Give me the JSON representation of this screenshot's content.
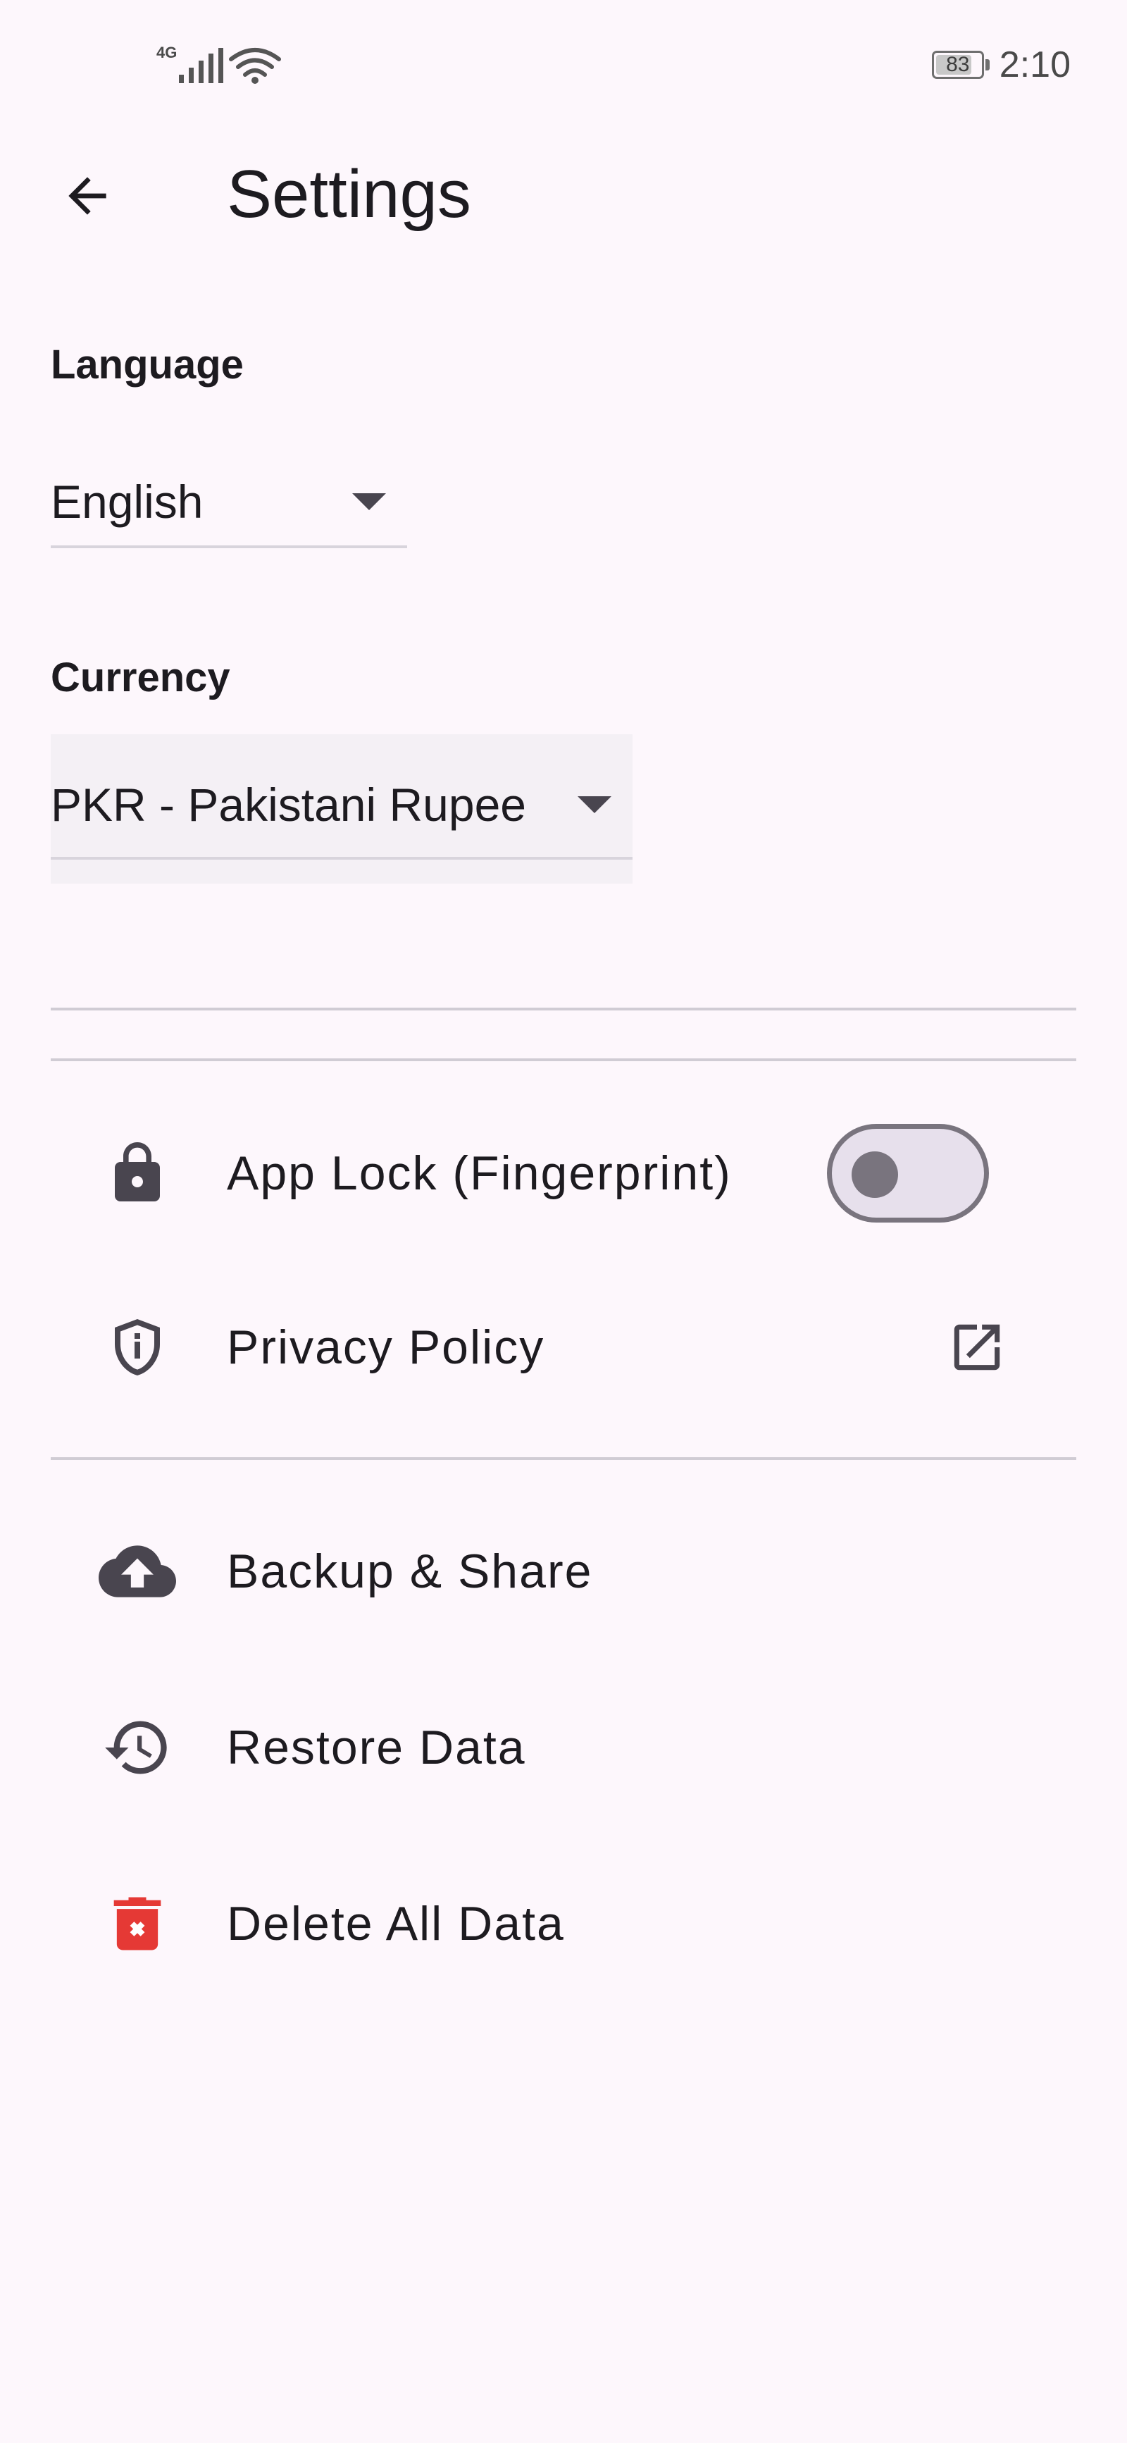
{
  "status_bar": {
    "network_type": "4G",
    "battery_level": "83",
    "battery_fraction": 0.83,
    "time": "2:10"
  },
  "app_bar": {
    "title": "Settings",
    "back_icon": "arrow-back-icon"
  },
  "language": {
    "label": "Language",
    "selected": "English"
  },
  "currency": {
    "label": "Currency",
    "selected": "PKR - Pakistani Rupee"
  },
  "settings_list": [
    {
      "label": "App Lock (Fingerprint)",
      "icon": "lock-icon",
      "trailing": "switch",
      "switch_on": false
    },
    {
      "label": "Privacy Policy",
      "icon": "shield-info-icon",
      "trailing": "external-link-icon"
    },
    {
      "label": "Backup & Share",
      "icon": "cloud-upload-icon"
    },
    {
      "label": "Restore Data",
      "icon": "history-icon"
    },
    {
      "label": "Delete All Data",
      "icon": "delete-icon"
    }
  ],
  "colors": {
    "background": "#fdf7fc",
    "text": "#1d1b20",
    "icon": "#49454f",
    "danger": "#e53935",
    "switch_outline": "#79747e"
  }
}
